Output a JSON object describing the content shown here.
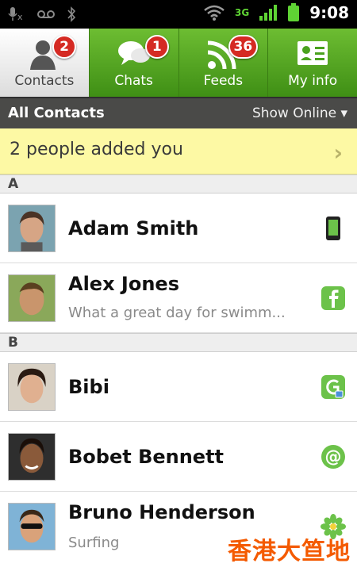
{
  "status_bar": {
    "time": "9:08",
    "icons": [
      "mic-muted-icon",
      "voicemail-icon",
      "bluetooth-icon",
      "wifi-icon",
      "3g-icon",
      "signal-icon",
      "battery-icon"
    ],
    "network_label": "3G"
  },
  "tabs": [
    {
      "label": "Contacts",
      "badge": "2",
      "icon": "person-icon",
      "active": true
    },
    {
      "label": "Chats",
      "badge": "1",
      "icon": "chat-bubbles-icon",
      "active": false
    },
    {
      "label": "Feeds",
      "badge": "36",
      "icon": "rss-icon",
      "active": false
    },
    {
      "label": "My info",
      "badge": "",
      "icon": "id-card-icon",
      "active": false
    }
  ],
  "list_header": {
    "title": "All Contacts",
    "filter": "Show Online ▾"
  },
  "notice": {
    "text": "2 people added you",
    "arrow": "›"
  },
  "sections": [
    {
      "letter": "A"
    },
    {
      "letter": "B"
    }
  ],
  "contacts": [
    {
      "name": "Adam Smith",
      "status": "",
      "service": "phone-icon"
    },
    {
      "name": "Alex Jones",
      "status": "What a great day for swimm...",
      "service": "facebook-icon"
    },
    {
      "name": "Bibi",
      "status": "",
      "service": "gtalk-icon"
    },
    {
      "name": "Bobet Bennett",
      "status": "",
      "service": "email-at-icon"
    },
    {
      "name": "Bruno Henderson",
      "status": "Surfing",
      "service": "icq-flower-icon"
    }
  ],
  "watermark": "香港大笪地",
  "colors": {
    "accent_green": "#4aa21e",
    "badge_red": "#d52a23",
    "notice_yellow": "#fdf9a4",
    "header_dark": "#4a4a48"
  }
}
